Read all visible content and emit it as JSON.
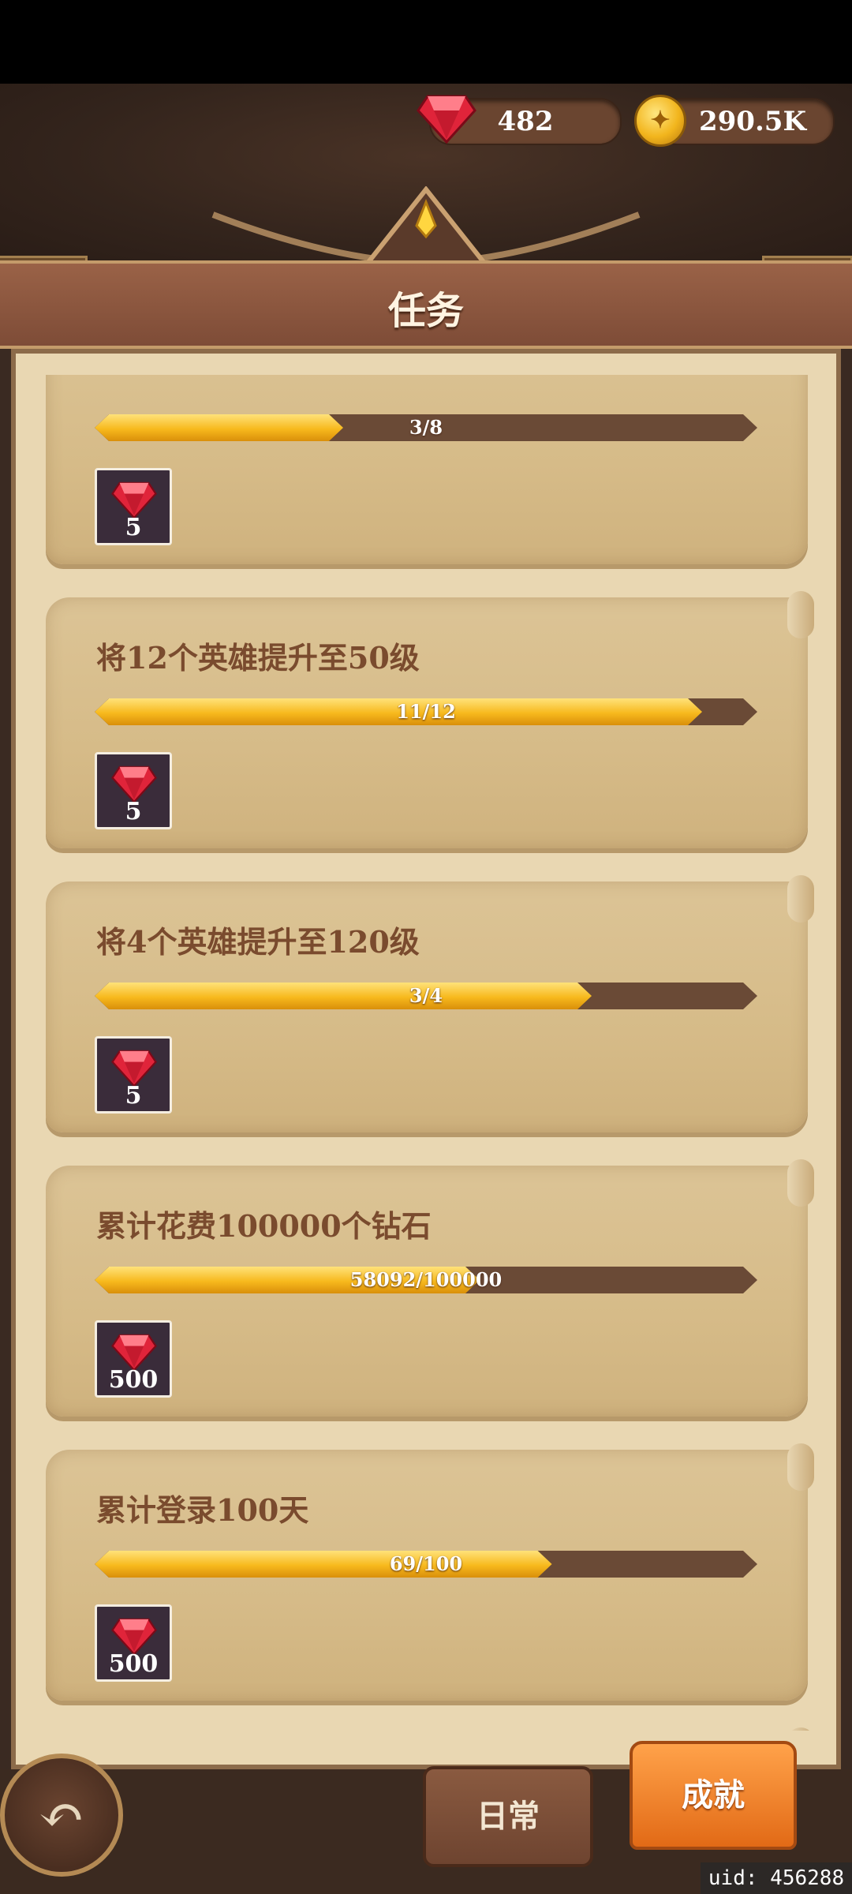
{
  "currency": {
    "gems": "482",
    "gold": "290.5K"
  },
  "title": "任务",
  "tasks": [
    {
      "desc": "",
      "progress_text": "3/8",
      "progress": 0.375,
      "reward": "5"
    },
    {
      "desc": "将12个英雄提升至50级",
      "progress_text": "11/12",
      "progress": 0.9167,
      "reward": "5"
    },
    {
      "desc": "将4个英雄提升至120级",
      "progress_text": "3/4",
      "progress": 0.75,
      "reward": "5"
    },
    {
      "desc": "累计花费100000个钻石",
      "progress_text": "58092/100000",
      "progress": 0.58092,
      "reward": "500"
    },
    {
      "desc": "累计登录100天",
      "progress_text": "69/100",
      "progress": 0.69,
      "reward": "500"
    }
  ],
  "tabs": {
    "daily": "日常",
    "achievements": "成就"
  },
  "uid": "uid: 456288",
  "colors": {
    "accent_orange": "#f07a22",
    "progress_gold": "#f7b91d",
    "gem_red": "#e0243a"
  }
}
